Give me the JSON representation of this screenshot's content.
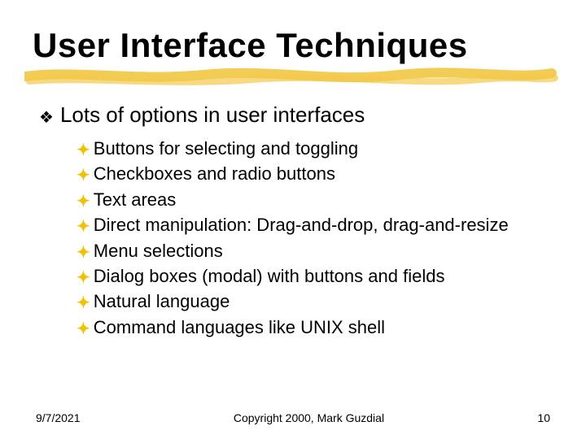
{
  "title": "User Interface Techniques",
  "bullet_main": "Lots of options in user interfaces",
  "sub_bullets": [
    "Buttons for selecting and toggling",
    "Checkboxes and radio buttons",
    "Text areas",
    "Direct manipulation: Drag-and-drop, drag-and-resize",
    "Menu selections",
    "Dialog boxes (modal) with buttons and fields",
    "Natural language",
    "Command languages like UNIX shell"
  ],
  "footer": {
    "date": "9/7/2021",
    "copyright": "Copyright 2000, Mark Guzdial",
    "page": "10"
  },
  "icons": {
    "lvl1": "❖",
    "lvl2": "✦"
  }
}
